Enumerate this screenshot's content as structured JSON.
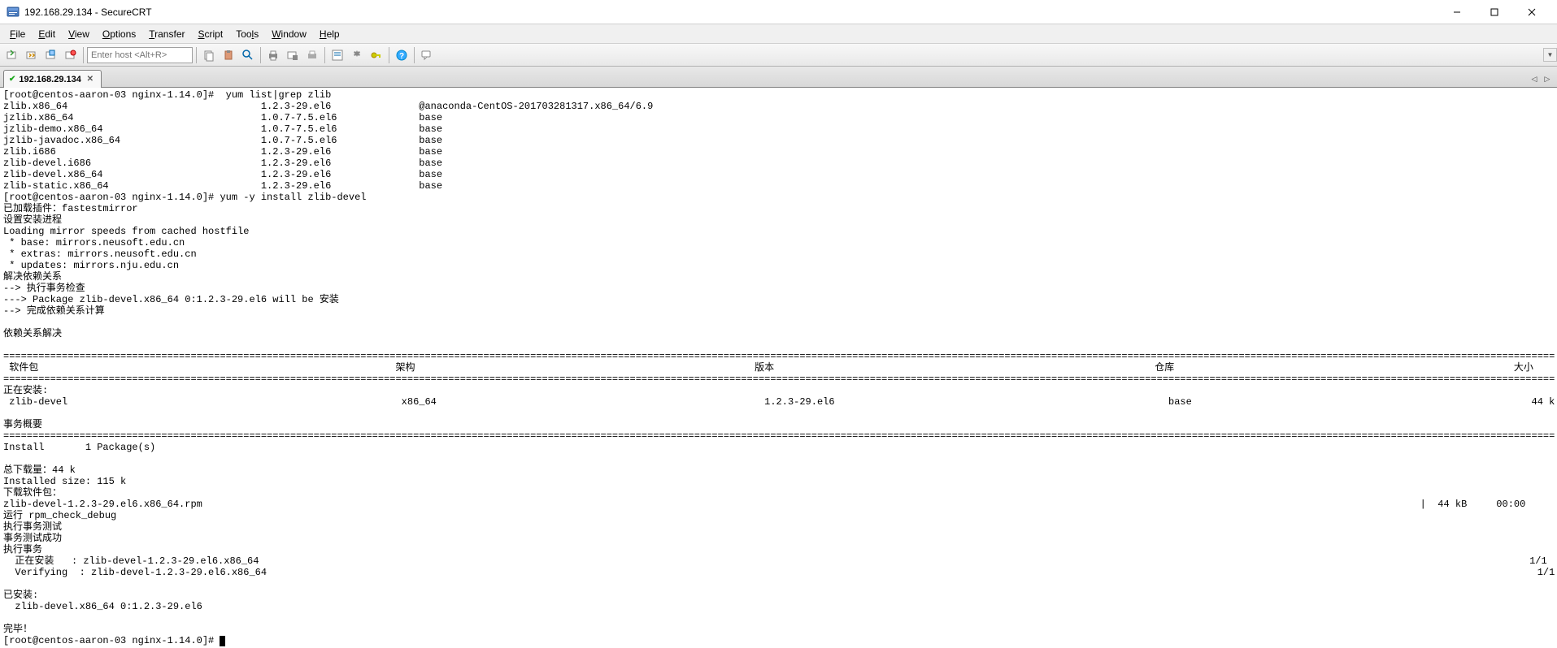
{
  "window": {
    "title": "192.168.29.134 - SecureCRT"
  },
  "menu": {
    "file": "File",
    "edit": "Edit",
    "view": "View",
    "options": "Options",
    "transfer": "Transfer",
    "script": "Script",
    "tools": "Tools",
    "window": "Window",
    "help": "Help"
  },
  "toolbar": {
    "host_placeholder": "Enter host <Alt+R>"
  },
  "tab": {
    "label": "192.168.29.134"
  },
  "terminal": {
    "lines": [
      "[root@centos-aaron-03 nginx-1.14.0]#  yum list|grep zlib",
      "zlib.x86_64                                 1.2.3-29.el6               @anaconda-CentOS-201703281317.x86_64/6.9",
      "jzlib.x86_64                                1.0.7-7.5.el6              base",
      "jzlib-demo.x86_64                           1.0.7-7.5.el6              base",
      "jzlib-javadoc.x86_64                        1.0.7-7.5.el6              base",
      "zlib.i686                                   1.2.3-29.el6               base",
      "zlib-devel.i686                             1.2.3-29.el6               base",
      "zlib-devel.x86_64                           1.2.3-29.el6               base",
      "zlib-static.x86_64                          1.2.3-29.el6               base",
      "[root@centos-aaron-03 nginx-1.14.0]# yum -y install zlib-devel",
      "已加载插件：fastestmirror",
      "设置安装进程",
      "Loading mirror speeds from cached hostfile",
      " * base: mirrors.neusoft.edu.cn",
      " * extras: mirrors.neusoft.edu.cn",
      " * updates: mirrors.nju.edu.cn",
      "解决依赖关系",
      "--> 执行事务检查",
      "---> Package zlib-devel.x86_64 0:1.2.3-29.el6 will be 安装",
      "--> 完成依赖关系计算",
      "",
      "依赖关系解决",
      "",
      "=========================================================================================================================================================================================================================================================================",
      " 软件包                                                             架构                                                          版本                                                                 仓库                                                          大小",
      "=========================================================================================================================================================================================================================================================================",
      "正在安装:",
      " zlib-devel                                                         x86_64                                                        1.2.3-29.el6                                                         base                                                          44 k",
      "",
      "事务概要",
      "=========================================================================================================================================================================================================================================================================",
      "Install       1 Package(s)",
      "",
      "总下载量：44 k",
      "Installed size: 115 k",
      "下载软件包：",
      "zlib-devel-1.2.3-29.el6.x86_64.rpm                                                                                                                                                                                                                |  44 kB     00:00",
      "运行 rpm_check_debug",
      "执行事务测试",
      "事务测试成功",
      "执行事务",
      "  正在安装   : zlib-devel-1.2.3-29.el6.x86_64                                                                                                                                                                                                                         1/1",
      "  Verifying  : zlib-devel-1.2.3-29.el6.x86_64                                                                                                                                                                                                                         1/1",
      "",
      "已安装:",
      "  zlib-devel.x86_64 0:1.2.3-29.el6",
      "",
      "完毕！",
      "[root@centos-aaron-03 nginx-1.14.0]# "
    ]
  }
}
